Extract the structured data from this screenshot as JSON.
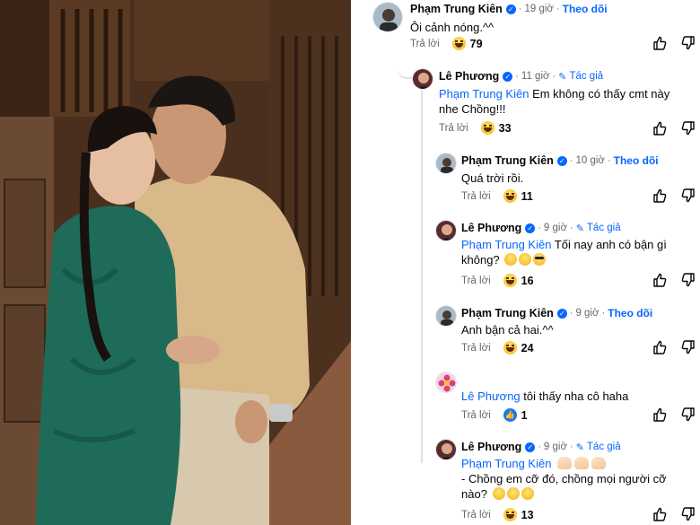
{
  "photo": {
    "alt_subject": "couple-photo",
    "colors": {
      "wood": "#4a2f1f",
      "dress": "#1f6b5a",
      "shirt": "#d9b88a",
      "pants": "#d8c8ad"
    }
  },
  "ui": {
    "reply_label": "Trả lời",
    "follow_label": "Theo dõi",
    "author_badge": "Tác giả",
    "accent": "#0866ff",
    "muted": "#65676b"
  },
  "comments": [
    {
      "id": "c1",
      "author": "Phạm Trung Kiên",
      "time": "19 giờ",
      "tag": "Theo dõi",
      "text": "Ôi cảnh nóng.^^",
      "reaction": "haha",
      "count": "79"
    },
    {
      "id": "c2",
      "author": "Lê Phương",
      "time": "11 giờ",
      "tag": "Tác giả",
      "mention": "Phạm Trung Kiên",
      "text": " Em không có thấy cmt này nhe Chồng!!!",
      "reaction": "haha",
      "count": "33"
    },
    {
      "id": "c3",
      "author": "Phạm Trung Kiên",
      "time": "10 giờ",
      "tag": "Theo dõi",
      "text": "Quá trời rồi.",
      "reaction": "haha",
      "count": "11"
    },
    {
      "id": "c4",
      "author": "Lê Phương",
      "time": "9 giờ",
      "tag": "Tác giả",
      "mention": "Phạm Trung Kiên",
      "text": " Tối nay anh có bận gì không?",
      "emojis": [
        "smirk-face",
        "relieved-face",
        "sunglasses-face"
      ],
      "reaction": "haha",
      "count": "16"
    },
    {
      "id": "c5",
      "author": "Phạm Trung Kiên",
      "time": "9 giờ",
      "tag": "Theo dõi",
      "text": "Anh bận cả hai.^^",
      "reaction": "haha",
      "count": "24"
    },
    {
      "id": "c6",
      "author": "",
      "mention": "Lê Phương",
      "text": " tôi thấy nha cô haha",
      "reaction": "like",
      "count": "1"
    },
    {
      "id": "c7",
      "author": "Lê Phương",
      "time": "9 giờ",
      "tag": "Tác giả",
      "mention": "Phạm Trung Kiên",
      "mention_emojis": [
        "clapping-hands",
        "clapping-hands",
        "clapping-hands"
      ],
      "text": "- Chồng em cỡ đó, chồng mọi người cỡ nào?",
      "emojis": [
        "rofl-face",
        "rofl-face",
        "rofl-face"
      ],
      "reaction": "haha",
      "count": "13"
    }
  ]
}
